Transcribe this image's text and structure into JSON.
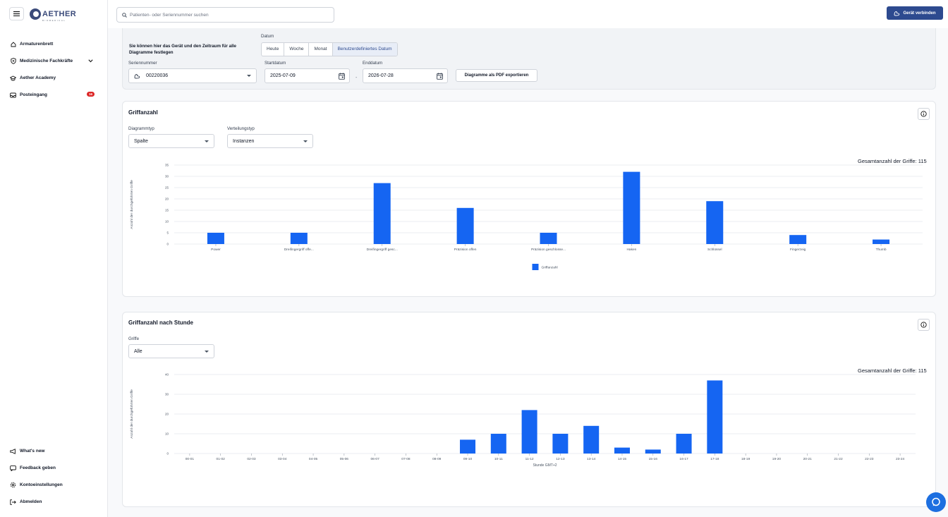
{
  "app": {
    "logo_text": "AETHER",
    "logo_sub": "BIOMEDICAL"
  },
  "sidebar": {
    "items": [
      {
        "label": "Armaturenbrett"
      },
      {
        "label": "Medizinische Fachkräfte"
      },
      {
        "label": "Aether Academy"
      },
      {
        "label": "Posteingang",
        "badge": "16"
      }
    ],
    "bottom_items": [
      {
        "label": "What's new"
      },
      {
        "label": "Feedback geben"
      },
      {
        "label": "Kontoeinstellungen"
      },
      {
        "label": "Abmelden"
      }
    ]
  },
  "topbar": {
    "search_placeholder": "Patienten- oder Seriennummer suchen",
    "connect_label": "Gerät verbinden"
  },
  "filter": {
    "hint": "Sie können hier das Gerät und den Zeitraum für alle Diagramme festlegen",
    "datum_label": "Datum",
    "ranges": [
      "Heute",
      "Woche",
      "Monat",
      "Benutzerdefiniertes Datum"
    ],
    "selected_range": "Benutzerdefiniertes Datum",
    "serial_label": "Seriennummer",
    "serial_value": "00220036",
    "start_label": "Startdatum",
    "start_value": "2025-07-09",
    "end_label": "Enddatum",
    "end_value": "2026-07-28",
    "dash": "-",
    "pdf_label": "Diagramme als PDF exportieren"
  },
  "card1": {
    "title": "Griffanzahl",
    "charttype_label": "Diagrammtyp",
    "charttype_value": "Spalte",
    "dist_label": "Verteilungstyp",
    "dist_value": "Instanzen",
    "total": "Gesamtanzahl der Griffe: 115"
  },
  "card2": {
    "title": "Griffanzahl nach Stunde",
    "grips_label": "Griffe",
    "grips_value": "Alle",
    "total": "Gesamtanzahl der Griffe: 115"
  },
  "chart_data": [
    {
      "type": "bar",
      "categories": [
        "Power",
        "Dreifingergriff offe...",
        "Dreifingergriff gesc...",
        "Präzision offen",
        "Präzision geschlosse...",
        "Haken",
        "Schlüssel",
        "Fingerzeig",
        "Thumb"
      ],
      "series": [
        {
          "name": "Griffanzahl",
          "values": [
            5,
            5,
            27,
            16,
            5,
            32,
            19,
            4,
            2
          ]
        }
      ],
      "ylabel": "Anzahl der durchgeführten Griffe",
      "xlabel": "",
      "ylim": [
        0,
        35
      ],
      "yticks": [
        0,
        5,
        10,
        15,
        20,
        25,
        30,
        35
      ],
      "grid": true,
      "legend": "bottom",
      "color": "#1565f2"
    },
    {
      "type": "bar",
      "categories": [
        "00-01",
        "01-02",
        "02-03",
        "03-04",
        "04-05",
        "05-06",
        "06-07",
        "07-08",
        "08-09",
        "09-10",
        "10-11",
        "11-12",
        "12-13",
        "13-14",
        "14-15",
        "15-16",
        "16-17",
        "17-18",
        "18-19",
        "19-20",
        "20-21",
        "21-22",
        "22-23",
        "23-24"
      ],
      "series": [
        {
          "values": [
            0,
            0,
            0,
            0,
            0,
            0,
            0,
            0,
            0,
            7,
            10,
            22,
            10,
            14,
            3,
            2,
            10,
            37,
            0,
            0,
            0,
            0,
            0,
            0
          ]
        }
      ],
      "ylabel": "Anzahl der durchgeführten Griffe",
      "xlabel": "Stunde GMT+2",
      "ylim": [
        0,
        40
      ],
      "yticks": [
        0,
        10,
        20,
        30,
        40
      ],
      "grid": true,
      "legend": "none",
      "color": "#1565f2"
    }
  ]
}
